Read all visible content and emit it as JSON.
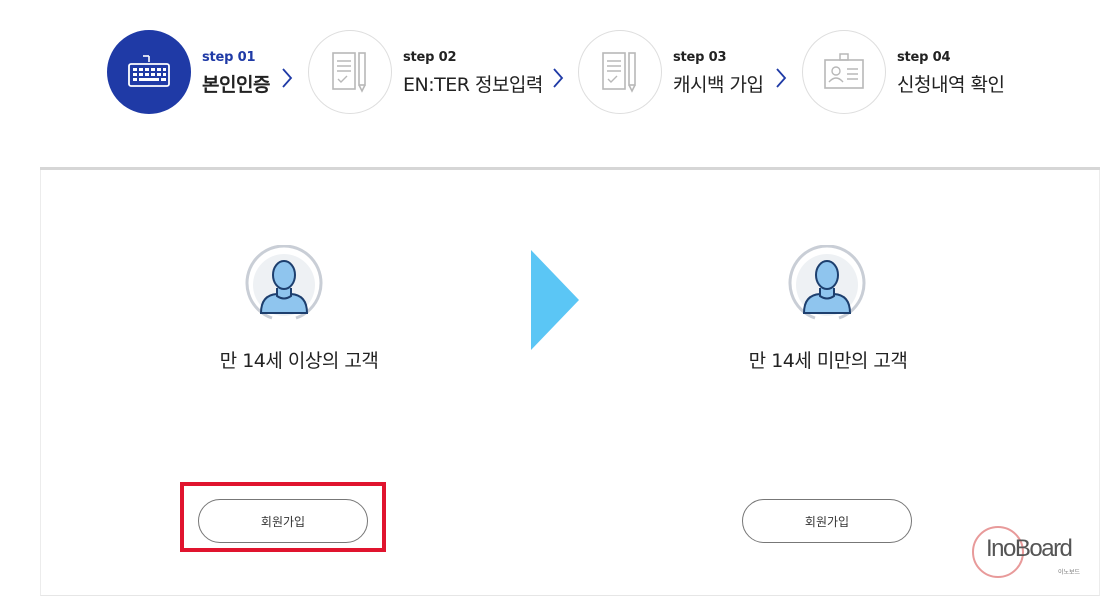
{
  "steps": [
    {
      "number": "step 01",
      "label": "본인인증",
      "icon": "keyboard-icon",
      "active": true
    },
    {
      "number": "step 02",
      "label": "EN:TER 정보입력",
      "icon": "document-pen-icon",
      "active": false
    },
    {
      "number": "step 03",
      "label": "캐시백 가입",
      "icon": "document-pen-icon",
      "active": false
    },
    {
      "number": "step 04",
      "label": "신청내역 확인",
      "icon": "id-card-icon",
      "active": false
    }
  ],
  "step_separator_icon": "chevron-right-icon",
  "options": [
    {
      "title": "만 14세 이상의 고객",
      "button_label": "회원가입",
      "icon": "user-avatar-icon",
      "highlighted": true
    },
    {
      "title": "만 14세 미만의 고객",
      "button_label": "회원가입",
      "icon": "user-avatar-icon",
      "highlighted": false
    }
  ],
  "divider_icon": "triangle-right-icon",
  "watermark": {
    "text": "InoBoard",
    "subtext": "이노보드"
  },
  "colors": {
    "active_step": "#1f3aa6",
    "arrow": "#5bc6f5",
    "avatar_fill": "#8fc5ee",
    "avatar_stroke": "#1d3f6e",
    "highlight_box": "#e0142e",
    "top_border": "#d6d6d6"
  }
}
